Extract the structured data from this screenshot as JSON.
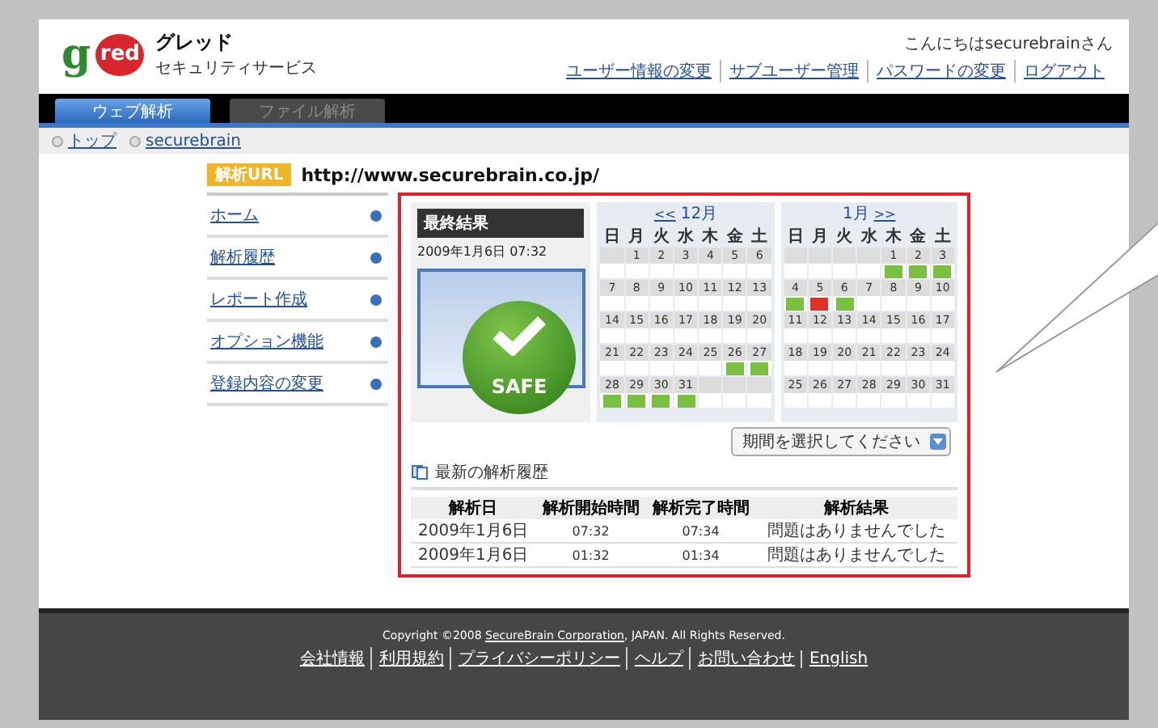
{
  "header": {
    "logo": {
      "initial": "g",
      "word": "red",
      "name": "グレッド",
      "tagline": "セキュリティサービス"
    },
    "greeting": "こんにちはsecurebrainさん",
    "links": [
      "ユーザー情報の変更",
      "サブユーザー管理",
      "パスワードの変更",
      "ログアウト"
    ]
  },
  "tabs": [
    {
      "label": "ウェブ解析",
      "selected": true
    },
    {
      "label": "ファイル解析",
      "selected": false
    }
  ],
  "breadcrumb": [
    "トップ",
    "securebrain"
  ],
  "url_bar": {
    "badge": "解析URL",
    "url": "http://www.securebrain.co.jp/"
  },
  "sidebar": {
    "items": [
      "ホーム",
      "解析履歴",
      "レポート作成",
      "オプション機能",
      "登録内容の変更"
    ]
  },
  "result": {
    "title": "最終結果",
    "timestamp": "2009年1月6日 07:32",
    "verdict": "SAFE"
  },
  "calendars": [
    {
      "prev": "<<",
      "month": "12月",
      "weekdays": [
        "日",
        "月",
        "火",
        "水",
        "木",
        "金",
        "土"
      ],
      "weeks": [
        {
          "days": [
            {
              "day": "1"
            },
            {
              "day": "2"
            },
            {
              "day": "3"
            },
            {
              "day": "4"
            },
            {
              "day": "5"
            },
            {
              "day": "6"
            }
          ]
        },
        {
          "days": [
            {
              "day": "7"
            },
            {
              "day": "8"
            },
            {
              "day": "9"
            },
            {
              "day": "10"
            },
            {
              "day": "11"
            },
            {
              "day": "12"
            },
            {
              "day": "13"
            }
          ]
        },
        {
          "days": [
            {
              "day": "14"
            },
            {
              "day": "15"
            },
            {
              "day": "16"
            },
            {
              "day": "17"
            },
            {
              "day": "18"
            },
            {
              "day": "19"
            },
            {
              "day": "20"
            }
          ]
        },
        {
          "days": [
            {
              "day": "21"
            },
            {
              "day": "22"
            },
            {
              "day": "23"
            },
            {
              "day": "24"
            },
            {
              "day": "25"
            },
            {
              "day": "26",
              "color": "#7ac142"
            },
            {
              "day": "27",
              "color": "#7ac142"
            }
          ]
        },
        {
          "days": [
            {
              "day": "28",
              "color": "#7ac142"
            },
            {
              "day": "29",
              "color": "#7ac142"
            },
            {
              "day": "30",
              "color": "#7ac142"
            },
            {
              "day": "31",
              "color": "#7ac142"
            }
          ]
        }
      ]
    },
    {
      "month": "1月",
      "next": ">>",
      "weekdays": [
        "日",
        "月",
        "火",
        "水",
        "木",
        "金",
        "土"
      ],
      "weeks": [
        {
          "days": [
            {
              "day": "1",
              "color": "#7ac142"
            },
            {
              "day": "2",
              "color": "#7ac142"
            },
            {
              "day": "3",
              "color": "#7ac142"
            }
          ]
        },
        {
          "days": [
            {
              "day": "4",
              "color": "#7ac142"
            },
            {
              "day": "5",
              "color": "#e0302c"
            },
            {
              "day": "6",
              "color": "#7ac142"
            },
            {
              "day": "7"
            },
            {
              "day": "8"
            },
            {
              "day": "9"
            },
            {
              "day": "10"
            }
          ]
        },
        {
          "days": [
            {
              "day": "11"
            },
            {
              "day": "12"
            },
            {
              "day": "13"
            },
            {
              "day": "14"
            },
            {
              "day": "15"
            },
            {
              "day": "16"
            },
            {
              "day": "17"
            }
          ]
        },
        {
          "days": [
            {
              "day": "18"
            },
            {
              "day": "19"
            },
            {
              "day": "20"
            },
            {
              "day": "21"
            },
            {
              "day": "22"
            },
            {
              "day": "23"
            },
            {
              "day": "24"
            }
          ]
        },
        {
          "days": [
            {
              "day": "25"
            },
            {
              "day": "26"
            },
            {
              "day": "27"
            },
            {
              "day": "28"
            },
            {
              "day": "29"
            },
            {
              "day": "30"
            },
            {
              "day": "31"
            }
          ]
        }
      ]
    }
  ],
  "period_select": {
    "value": "期間を選択してください"
  },
  "history": {
    "title": "最新の解析履歴",
    "columns": [
      "解析日",
      "解析開始時間",
      "解析完了時間",
      "解析結果"
    ],
    "rows": [
      [
        "2009年1月6日",
        "07:32",
        "07:34",
        "問題はありませんでした"
      ],
      [
        "2009年1月6日",
        "01:32",
        "01:34",
        "問題はありませんでした"
      ]
    ]
  },
  "footer": {
    "copyright_before": "Copyright ©2008 ",
    "company": "SecureBrain Corporation",
    "copyright_after": ", JAPAN. All Rights Reserved.",
    "links": [
      "会社情報",
      "利用規約",
      "プライバシーポリシー",
      "ヘルプ",
      "お問い合わせ",
      "English"
    ]
  }
}
